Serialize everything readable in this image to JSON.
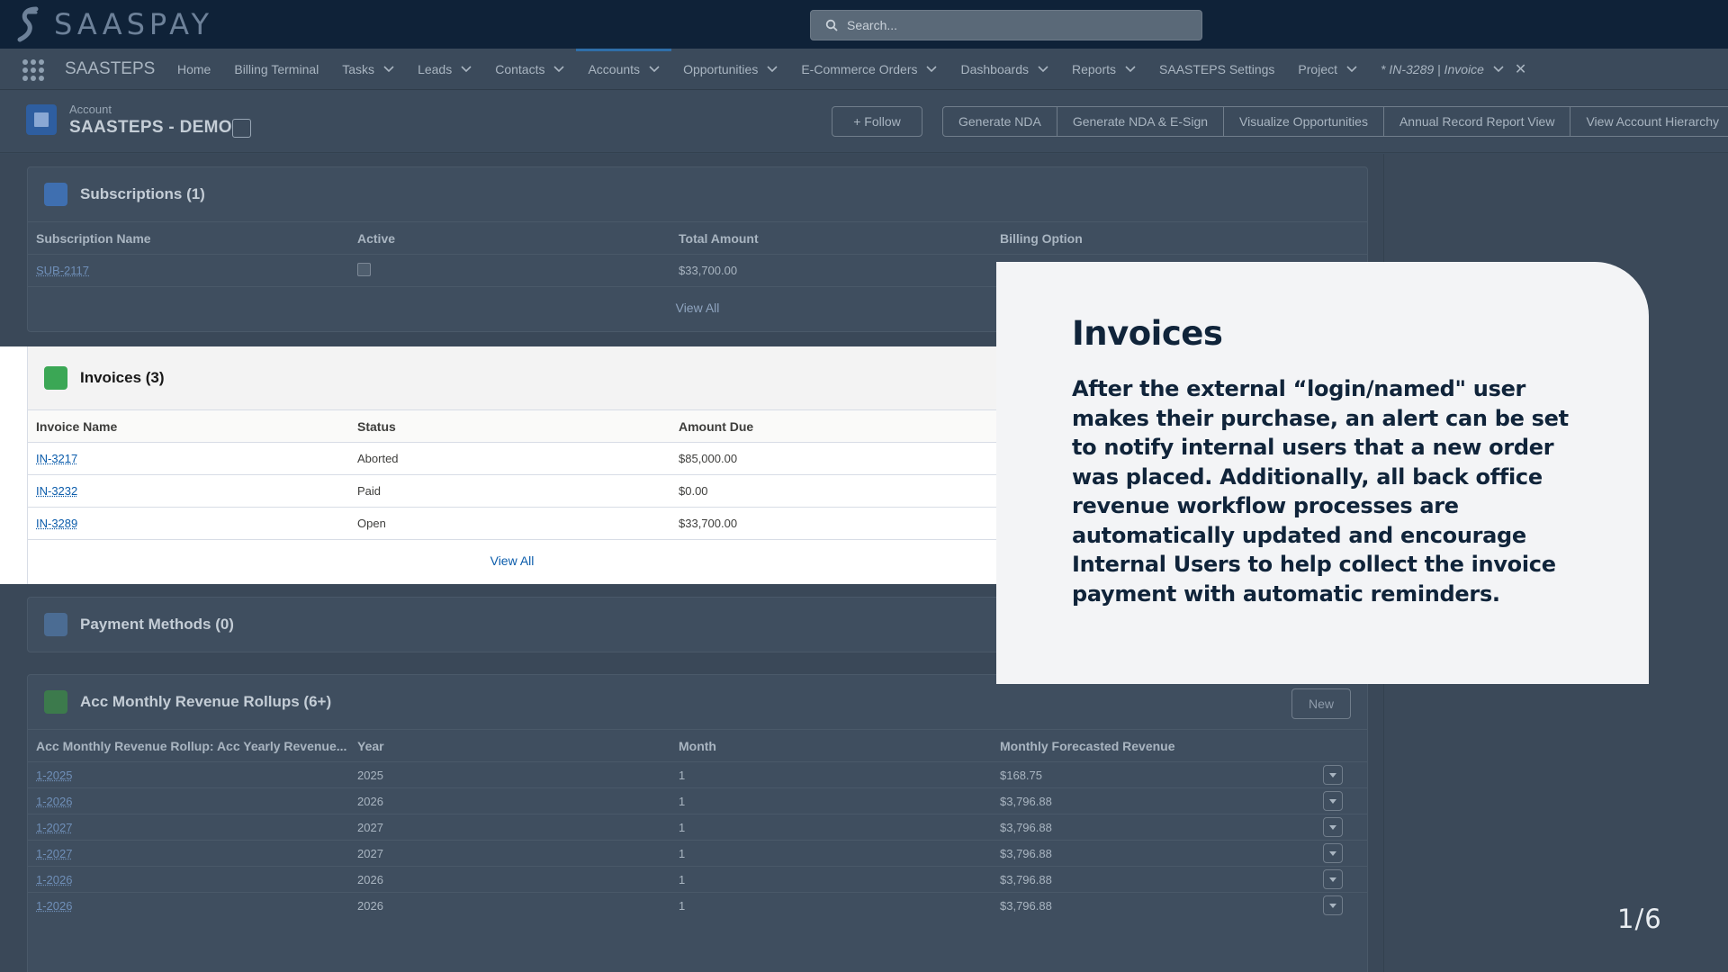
{
  "app": {
    "logo_text": "SAASPAY",
    "name": "SAASTEPS"
  },
  "search": {
    "placeholder": "Search..."
  },
  "nav": {
    "items": [
      {
        "label": "Home",
        "has_menu": false
      },
      {
        "label": "Billing Terminal",
        "has_menu": false
      },
      {
        "label": "Tasks",
        "has_menu": true
      },
      {
        "label": "Leads",
        "has_menu": true
      },
      {
        "label": "Contacts",
        "has_menu": true
      },
      {
        "label": "Accounts",
        "has_menu": true,
        "active": true
      },
      {
        "label": "Opportunities",
        "has_menu": true
      },
      {
        "label": "E-Commerce Orders",
        "has_menu": true
      },
      {
        "label": "Dashboards",
        "has_menu": true
      },
      {
        "label": "Reports",
        "has_menu": true
      },
      {
        "label": "SAASTEPS Settings",
        "has_menu": false
      },
      {
        "label": "Project",
        "has_menu": true
      }
    ],
    "open_tab": "* IN-3289 | Invoice"
  },
  "record": {
    "type": "Account",
    "title": "SAASTEPS - DEMO",
    "follow_label": "+ Follow",
    "actions": [
      "Generate NDA",
      "Generate NDA & E-Sign",
      "Visualize Opportunities",
      "Annual Record Report View",
      "View Account Hierarchy"
    ]
  },
  "subscriptions": {
    "title": "Subscriptions (1)",
    "columns": [
      "Subscription Name",
      "Active",
      "Total Amount",
      "Billing Option"
    ],
    "rows": [
      {
        "name": "SUB-2117",
        "active": true,
        "total": "$33,700.00",
        "billing": ""
      }
    ],
    "view_all": "View All"
  },
  "invoices": {
    "title": "Invoices (3)",
    "columns": [
      "Invoice Name",
      "Status",
      "Amount Due"
    ],
    "rows": [
      {
        "name": "IN-3217",
        "status": "Aborted",
        "amount": "$85,000.00"
      },
      {
        "name": "IN-3232",
        "status": "Paid",
        "amount": "$0.00"
      },
      {
        "name": "IN-3289",
        "status": "Open",
        "amount": "$33,700.00"
      }
    ],
    "view_all": "View All"
  },
  "payment_methods": {
    "title": "Payment Methods (0)"
  },
  "rollups": {
    "title": "Acc Monthly Revenue Rollups (6+)",
    "new_label": "New",
    "columns": [
      "Acc Monthly Revenue Rollup: Acc Yearly Revenue...",
      "Year",
      "Month",
      "Monthly Forecasted Revenue"
    ],
    "rows": [
      {
        "name": "1-2025",
        "year": "2025",
        "month": "1",
        "revenue": "$168.75"
      },
      {
        "name": "1-2026",
        "year": "2026",
        "month": "1",
        "revenue": "$3,796.88"
      },
      {
        "name": "1-2027",
        "year": "2027",
        "month": "1",
        "revenue": "$3,796.88"
      },
      {
        "name": "1-2027",
        "year": "2027",
        "month": "1",
        "revenue": "$3,796.88"
      },
      {
        "name": "1-2026",
        "year": "2026",
        "month": "1",
        "revenue": "$3,796.88"
      },
      {
        "name": "1-2026",
        "year": "2026",
        "month": "1",
        "revenue": "$3,796.88"
      }
    ]
  },
  "callout": {
    "title": "Invoices",
    "body": "After the external “login/named\" user makes their purchase, an alert can be set to notify internal users that a new order was placed. Additionally, all back office revenue workflow processes are automatically updated and encourage Internal Users to help collect the invoice payment with automatic reminders."
  },
  "pager": "1/6",
  "colors": {
    "top_bar": "#0f2238",
    "callout_text": "#10243a",
    "link": "#0b5cab",
    "active_tab": "#2f6ea8"
  }
}
